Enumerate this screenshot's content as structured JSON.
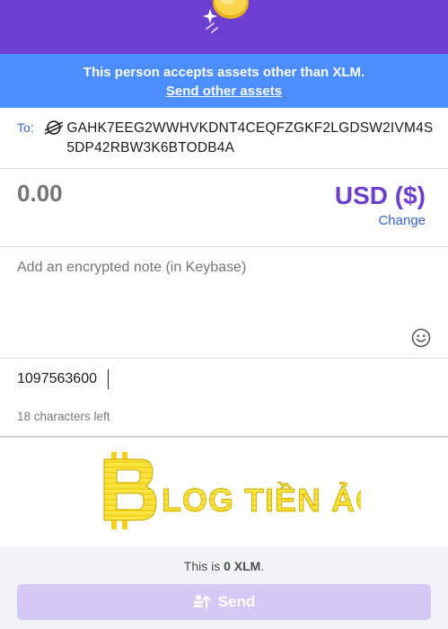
{
  "header": {
    "icon": "coin-sparkle-icon",
    "bg_color": "#6d3fd0"
  },
  "banner": {
    "message": "This person accepts assets other than XLM.",
    "link_label": "Send other assets",
    "bg_color": "#4c8eff"
  },
  "recipient": {
    "label": "To:",
    "icon": "stellar-icon",
    "address": "GAHK7EEG2WWHVKDNT4CEQFZGKF2LGDSW2IVM4S5DP42RBW3K6BTODB4A"
  },
  "amount": {
    "value": "0.00",
    "currency": "USD ($)",
    "change_label": "Change"
  },
  "note": {
    "placeholder": "Add an encrypted note (in Keybase)",
    "emoji_icon": "smiley-icon"
  },
  "memo": {
    "value": "1097563600",
    "chars_left": "18 characters left"
  },
  "watermark": {
    "text": "BLOG TIỀN ẢO"
  },
  "footer": {
    "balance_prefix": "This is ",
    "balance_value": "0 XLM",
    "balance_suffix": ".",
    "send_label": "Send",
    "send_icon": "send-money-icon"
  },
  "colors": {
    "accent": "#6d3fd0",
    "link": "#3663d8",
    "send_disabled": "#d5c8f5"
  }
}
